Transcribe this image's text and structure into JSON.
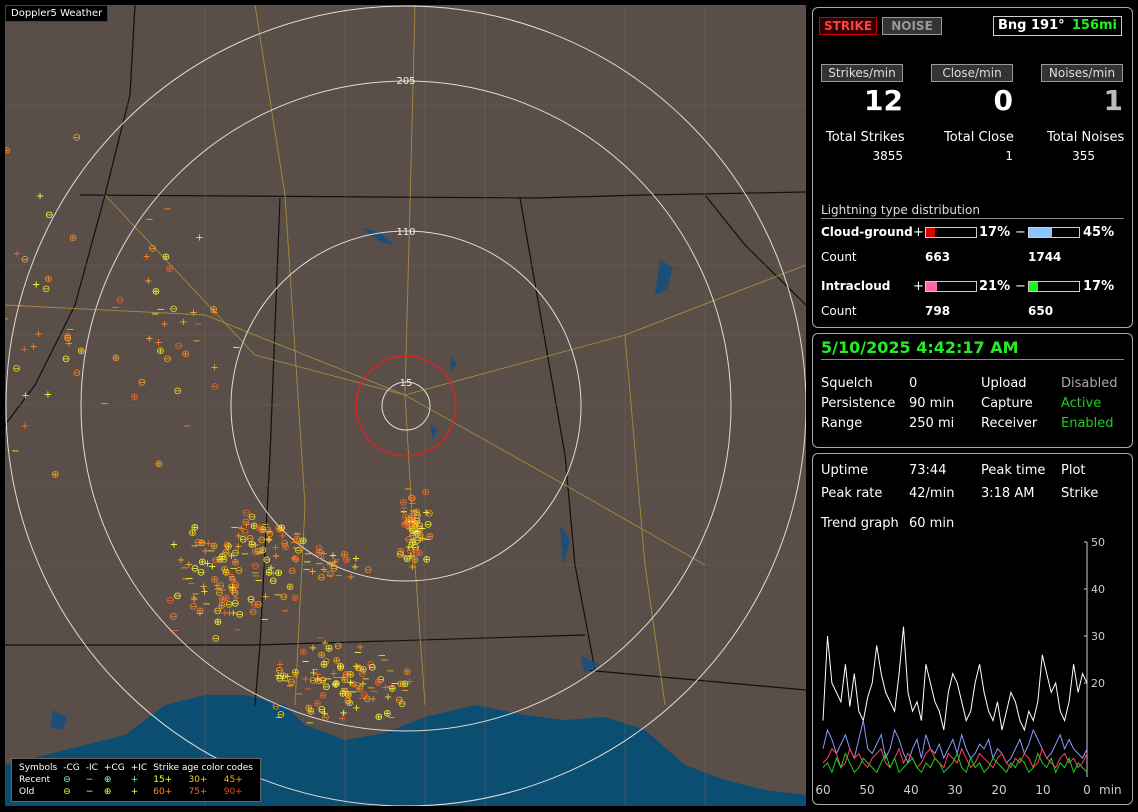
{
  "app_title": "Doppler5 Weather",
  "map": {
    "range_labels": [
      "205",
      "110",
      "15"
    ],
    "legend": {
      "header": [
        "Symbols",
        "-CG",
        "-IC",
        "+CG",
        "+IC",
        "Strike age color codes"
      ],
      "recent_label": "Recent",
      "old_label": "Old",
      "recent_codes": [
        "15+",
        "30+",
        "45+"
      ],
      "old_codes": [
        "60+",
        "75+",
        "90+"
      ]
    }
  },
  "status": {
    "strike_btn": "STRIKE",
    "noise_btn": "NOISE",
    "bearing": "Bng 191°",
    "distance": "156mi"
  },
  "rates": {
    "strikes_label": "Strikes/min",
    "strikes": "12",
    "close_label": "Close/min",
    "close": "0",
    "noises_label": "Noises/min",
    "noises": "1"
  },
  "totals": {
    "strikes_label": "Total Strikes",
    "strikes": "3855",
    "close_label": "Total Close",
    "close": "1",
    "noises_label": "Total Noises",
    "noises": "355"
  },
  "distribution": {
    "title": "Lightning type distribution",
    "cg_label": "Cloud-ground",
    "ic_label": "Intracloud",
    "count_label": "Count",
    "plus": "+",
    "minus": "−",
    "cg_pos_pct": "17%",
    "cg_neg_pct": "45%",
    "ic_pos_pct": "21%",
    "ic_neg_pct": "17%",
    "cg_pos_count": "663",
    "cg_neg_count": "1744",
    "ic_pos_count": "798",
    "ic_neg_count": "650",
    "cg_pos_frac": 0.17,
    "cg_neg_frac": 0.45,
    "ic_pos_frac": 0.21,
    "ic_neg_frac": 0.17,
    "colors": {
      "cg_pos": "#e00000",
      "cg_neg": "#88c8ff",
      "ic_pos": "#ff66aa",
      "ic_neg": "#22ee22"
    }
  },
  "info": {
    "datetime": "5/10/2025 4:42:17 AM",
    "squelch_label": "Squelch",
    "squelch": "0",
    "persistence_label": "Persistence",
    "persistence": "90 min",
    "range_label": "Range",
    "range": "250 mi",
    "upload_label": "Upload",
    "upload": "Disabled",
    "capture_label": "Capture",
    "capture": "Active",
    "receiver_label": "Receiver",
    "receiver": "Enabled"
  },
  "stats": {
    "uptime_label": "Uptime",
    "uptime": "73:44",
    "peak_time_label": "Peak time",
    "peak_time": "3:18 AM",
    "plot_label": "Plot",
    "plot": "Strike",
    "peak_rate_label": "Peak rate",
    "peak_rate": "42/min",
    "trend_label": "Trend graph",
    "trend": "60 min"
  },
  "chart_data": {
    "type": "line",
    "xlabel": "min",
    "x_ticks": [
      "60",
      "50",
      "40",
      "30",
      "20",
      "10",
      "0"
    ],
    "y_ticks": [
      "50",
      "40",
      "30",
      "20"
    ],
    "xlim": [
      60,
      0
    ],
    "ylim": [
      0,
      50
    ],
    "series": [
      {
        "color": "#ffffff",
        "values": [
          12,
          30,
          20,
          18,
          16,
          24,
          15,
          22,
          14,
          12,
          17,
          20,
          28,
          22,
          18,
          16,
          14,
          22,
          32,
          18,
          14,
          16,
          12,
          24,
          20,
          16,
          14,
          10,
          18,
          22,
          20,
          16,
          12,
          14,
          20,
          24,
          18,
          14,
          12,
          16,
          10,
          14,
          18,
          16,
          12,
          10,
          14,
          12,
          16,
          26,
          22,
          18,
          20,
          14,
          12,
          16,
          24,
          18,
          22,
          20
        ]
      },
      {
        "color": "#8899ff",
        "values": [
          6,
          10,
          8,
          5,
          7,
          9,
          6,
          4,
          8,
          12,
          6,
          5,
          7,
          9,
          4,
          6,
          10,
          8,
          5,
          3,
          6,
          8,
          4,
          9,
          6,
          5,
          7,
          4,
          6,
          8,
          5,
          9,
          6,
          4,
          5,
          7,
          6,
          8,
          4,
          6,
          5,
          3,
          4,
          6,
          8,
          5,
          7,
          10,
          8,
          6,
          4,
          5,
          7,
          9,
          6,
          8,
          6,
          5,
          4,
          6
        ]
      },
      {
        "color": "#ff4060",
        "values": [
          3,
          4,
          6,
          5,
          2,
          3,
          6,
          4,
          5,
          3,
          2,
          4,
          5,
          6,
          3,
          2,
          4,
          6,
          3,
          5,
          4,
          2,
          3,
          5,
          6,
          4,
          3,
          2,
          5,
          4,
          3,
          6,
          4,
          2,
          3,
          5,
          4,
          3,
          2,
          4,
          5,
          3,
          2,
          4,
          3,
          5,
          4,
          2,
          3,
          6,
          4,
          3,
          2,
          4,
          5,
          3,
          4,
          2,
          3,
          5
        ]
      },
      {
        "color": "#22cc22",
        "values": [
          2,
          3,
          1,
          4,
          2,
          5,
          3,
          1,
          2,
          4,
          3,
          2,
          1,
          3,
          5,
          2,
          4,
          1,
          2,
          3,
          4,
          2,
          1,
          3,
          2,
          4,
          3,
          1,
          2,
          3,
          5,
          2,
          1,
          4,
          2,
          3,
          1,
          2,
          4,
          3,
          2,
          1,
          3,
          2,
          4,
          3,
          1,
          2,
          5,
          3,
          2,
          4,
          1,
          3,
          2,
          4,
          1,
          3,
          2,
          1
        ]
      }
    ]
  }
}
